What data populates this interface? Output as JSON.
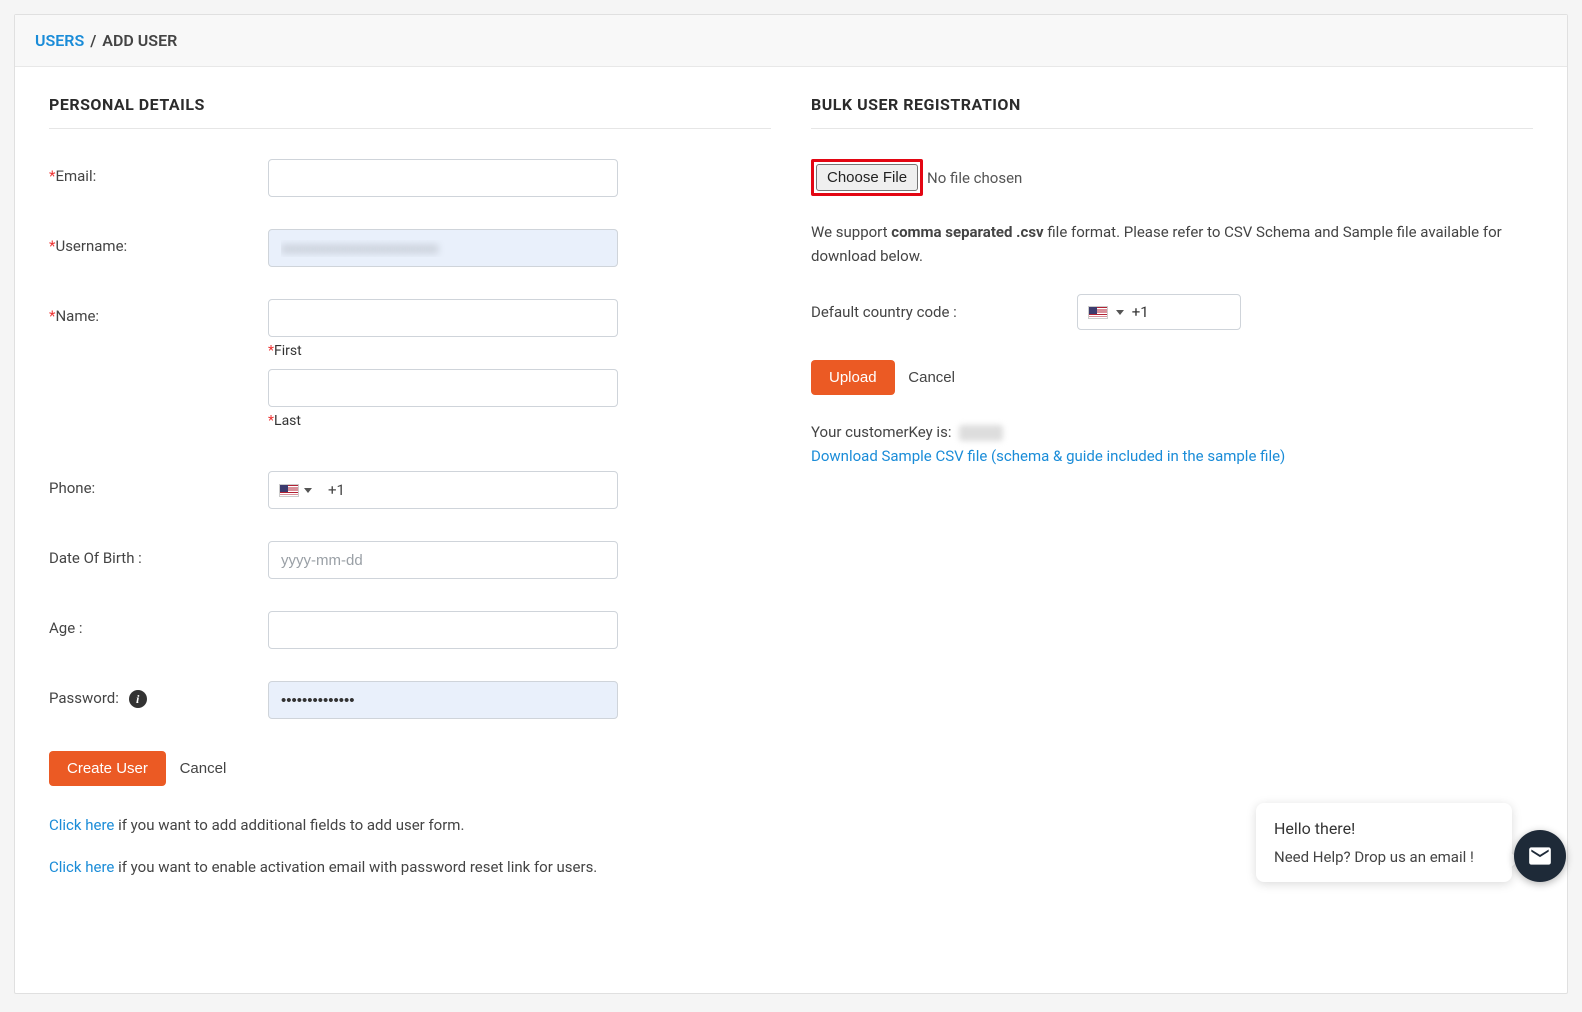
{
  "breadcrumb": {
    "parent": "USERS",
    "sep": "/",
    "current": "ADD USER"
  },
  "left": {
    "title": "PERSONAL DETAILS",
    "email_label": "Email:",
    "username_label": "Username:",
    "name_label": "Name:",
    "first_label": "First",
    "last_label": "Last",
    "phone_label": "Phone:",
    "phone_code": "+1",
    "dob_label": "Date Of Birth :",
    "dob_placeholder": "yyyy-mm-dd",
    "age_label": "Age :",
    "password_label": "Password:",
    "password_value": "••••••••••••••",
    "create_btn": "Create User",
    "cancel_btn": "Cancel",
    "help1_link": "Click here",
    "help1_rest": " if you want to add additional fields to add user form.",
    "help2_link": "Click here",
    "help2_rest": " if you want to enable activation email with password reset link for users."
  },
  "right": {
    "title": "BULK USER REGISTRATION",
    "choose_file": "Choose File",
    "no_file": "No file chosen",
    "support_pre": "We support ",
    "support_bold": "comma separated .csv",
    "support_post": " file format. Please refer to CSV Schema and Sample file available for download below.",
    "cc_label": "Default country code :",
    "cc_value": "+1",
    "upload_btn": "Upload",
    "cancel_btn": "Cancel",
    "ck_label": "Your customerKey is: ",
    "dl_link": "Download Sample CSV file (schema & guide included in the sample file)"
  },
  "chat": {
    "line1": "Hello there!",
    "line2": "Need Help? Drop us an email !"
  }
}
